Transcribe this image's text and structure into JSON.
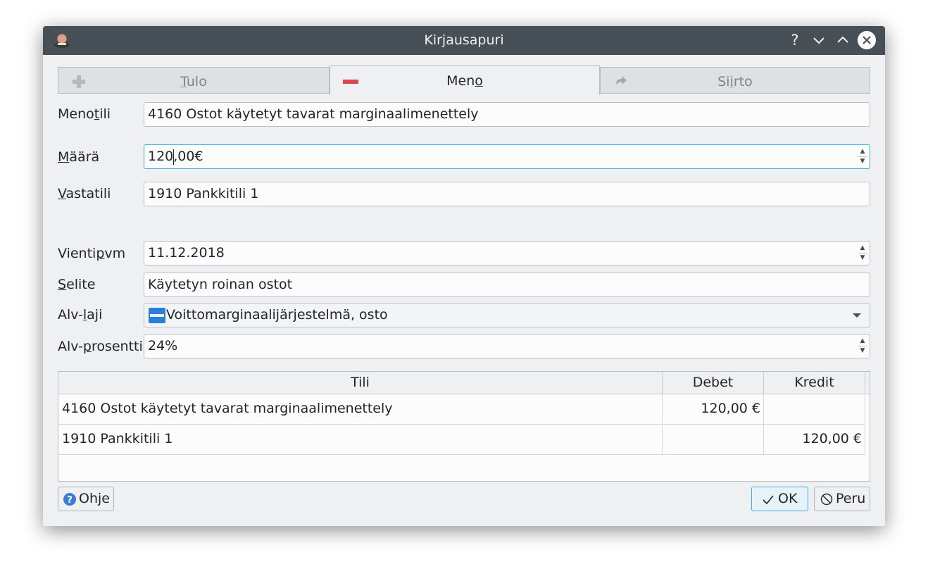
{
  "window": {
    "title": "Kirjausapuri"
  },
  "titlebar": {
    "help": "?",
    "minimize": "⌄",
    "maximize": "⌃",
    "close": "✕"
  },
  "tabs": [
    {
      "pre": "",
      "u": "T",
      "post": "ulo",
      "active": false
    },
    {
      "pre": "Men",
      "u": "o",
      "post": "",
      "active": true
    },
    {
      "pre": "Si",
      "u": "i",
      "post": "rto",
      "active": false
    }
  ],
  "form": {
    "menotili": {
      "label_pre": "Meno",
      "label_u": "t",
      "label_post": "ili",
      "value": "4160 Ostot käytetyt tavarat marginaalimenettely"
    },
    "maara": {
      "label_pre": "",
      "label_u": "M",
      "label_post": "äärä",
      "value_before_caret": "120",
      "value_after_caret": ",00€"
    },
    "vastatili": {
      "label_pre": "",
      "label_u": "V",
      "label_post": "astatili",
      "value": "1910 Pankkitili 1"
    },
    "vientipvm": {
      "label_pre": "Vienti",
      "label_u": "p",
      "label_post": "vm",
      "value": "11.12.2018"
    },
    "selite": {
      "label_pre": "",
      "label_u": "S",
      "label_post": "elite",
      "value": "Käytetyn roinan ostot"
    },
    "alvlaji": {
      "label_pre": "Alv-",
      "label_u": "l",
      "label_post": "aji",
      "value": "Voittomarginaalijärjestelmä, osto"
    },
    "alvprosentti": {
      "label_pre": "Alv-",
      "label_u": "p",
      "label_post": "rosentti",
      "value": "24%"
    }
  },
  "table": {
    "headers": [
      "Tili",
      "Debet",
      "Kredit"
    ],
    "rows": [
      {
        "tili": "4160 Ostot käytetyt tavarat marginaalimenettely",
        "debet": "120,00 €",
        "kredit": ""
      },
      {
        "tili": "1910 Pankkitili 1",
        "debet": "",
        "kredit": "120,00 €"
      }
    ]
  },
  "buttons": {
    "help": "Ohje",
    "ok": "OK",
    "cancel": "Peru"
  },
  "colors": {
    "titlebar": "#475057",
    "background": "#eff0f1",
    "focus": "#3daee9",
    "minus_icon": "#da4453"
  }
}
